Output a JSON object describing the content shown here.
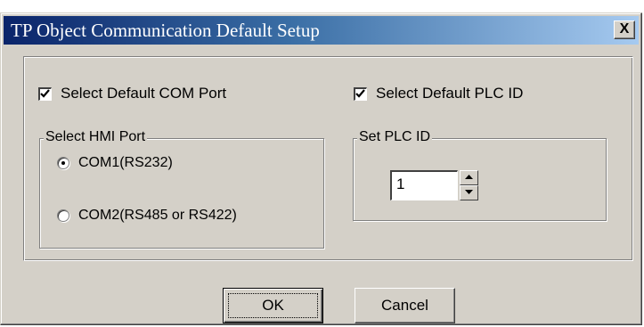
{
  "window": {
    "title": "TP Object Communication Default Setup",
    "close_label": "X"
  },
  "com_port": {
    "checkbox_label": "Select Default COM Port",
    "checked": true,
    "group_label": "Select HMI Port",
    "options": [
      {
        "label": "COM1(RS232)",
        "selected": true
      },
      {
        "label": "COM2(RS485 or RS422)",
        "selected": false
      }
    ]
  },
  "plc_id": {
    "checkbox_label": "Select Default PLC ID",
    "checked": true,
    "group_label": "Set PLC ID",
    "value": "1"
  },
  "buttons": {
    "ok_label": "OK",
    "cancel_label": "Cancel"
  },
  "colors": {
    "dialog_face": "#d4d0c8",
    "titlebar_start": "#0a246a",
    "titlebar_end": "#a6caf0"
  }
}
